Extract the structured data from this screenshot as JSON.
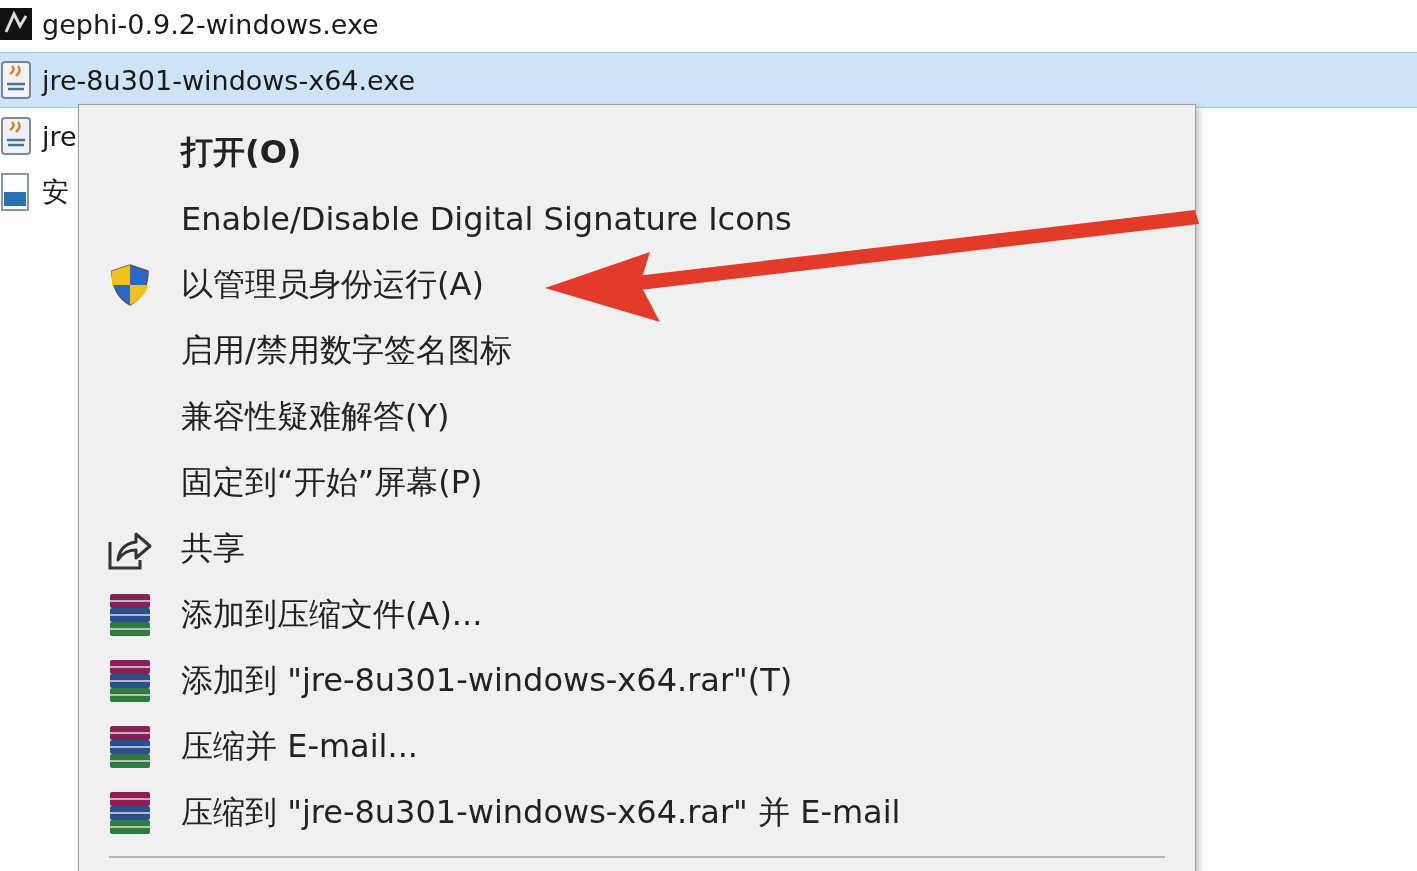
{
  "files": [
    {
      "name": "gephi-0.9.2-windows.exe",
      "kind": "app",
      "selected": false
    },
    {
      "name": "jre-8u301-windows-x64.exe",
      "kind": "java",
      "selected": true
    },
    {
      "name": "jre",
      "kind": "java",
      "selected": false
    },
    {
      "name": "安",
      "kind": "image",
      "selected": false
    }
  ],
  "context_menu": {
    "items": [
      {
        "label": "打开(O)",
        "default": true
      },
      {
        "label": "Enable/Disable Digital Signature Icons",
        "default": false
      },
      {
        "label": "以管理员身份运行(A)",
        "default": false,
        "kind": "shield"
      },
      {
        "label": "启用/禁用数字签名图标",
        "default": false
      },
      {
        "label": "兼容性疑难解答(Y)",
        "default": false
      },
      {
        "label": "固定到“开始”屏幕(P)",
        "default": false
      },
      {
        "label": "共享",
        "default": false,
        "kind": "share"
      },
      {
        "label": "添加到压缩文件(A)...",
        "default": false,
        "kind": "archive"
      },
      {
        "label": "添加到 \"jre-8u301-windows-x64.rar\"(T)",
        "default": false,
        "kind": "archive"
      },
      {
        "label": "压缩并 E-mail...",
        "default": false,
        "kind": "archive"
      },
      {
        "label": "压缩到 \"jre-8u301-windows-x64.rar\" 并 E-mail",
        "default": false,
        "kind": "archive"
      }
    ]
  }
}
